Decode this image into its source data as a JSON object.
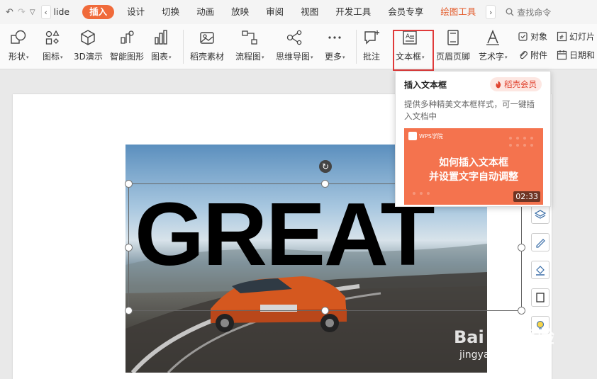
{
  "quick_access": {
    "undo": "↶",
    "redo": "↷",
    "customize": "▽"
  },
  "tabs": {
    "slide_partial": "lide",
    "items": [
      "插入",
      "设计",
      "切换",
      "动画",
      "放映",
      "审阅",
      "视图",
      "开发工具",
      "会员专享",
      "绘图工具"
    ],
    "search": "查找命令"
  },
  "ribbon": {
    "shape": "形状",
    "icon": "图标",
    "model3d": "3D演示",
    "smart": "智能图形",
    "chart": "图表",
    "docer": "稻壳素材",
    "flow": "流程图",
    "mind": "思维导图",
    "more": "更多",
    "comment": "批注",
    "textbox": "文本框",
    "header": "页眉页脚",
    "art": "艺术字",
    "object": "对象",
    "attach": "附件",
    "slide_num": "幻灯片",
    "date": "日期和"
  },
  "tooltip": {
    "title": "插入文本框",
    "badge": "稻壳会员",
    "desc": "提供多种精美文本框样式，可一键插入文档中",
    "thumb_brand": "WPS学院",
    "thumb_line1": "如何插入文本框",
    "thumb_line2": "并设置文字自动调整",
    "duration": "02:33"
  },
  "slide": {
    "text": "GREAT"
  },
  "watermark": {
    "text": "Bai du 经验",
    "url": "jingyan.baidu.com"
  },
  "colors": {
    "accent": "#f06a3a",
    "highlight": "#e03a3a",
    "badge_bg": "#fde7e2",
    "thumb_bg": "#f4734e"
  }
}
